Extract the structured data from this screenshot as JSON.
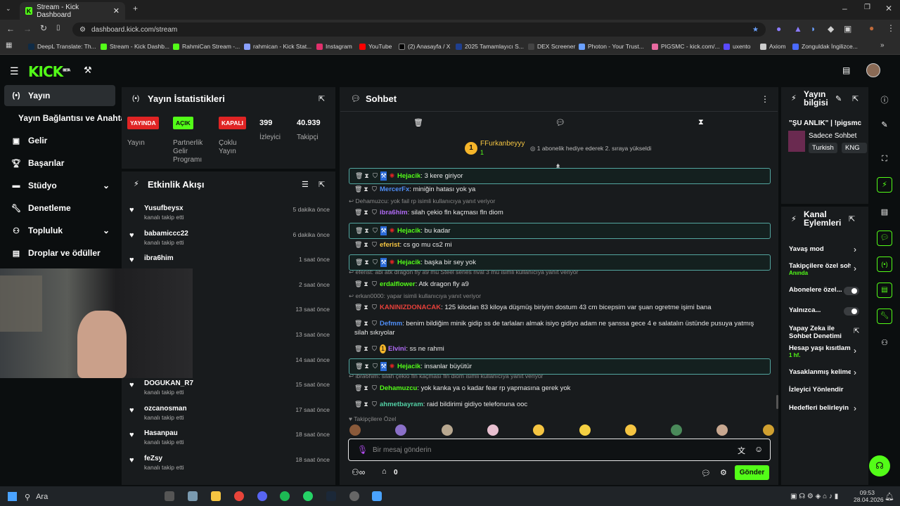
{
  "browser": {
    "tab_title": "Stream - Kick Dashboard",
    "url": "dashboard.kick.com/stream",
    "bookmarks": [
      "DeepL Translate: Th...",
      "Stream - Kick Dashb...",
      "RahmiCan Stream -...",
      "rahmican - Kick Stat...",
      "Instagram",
      "YouTube",
      "(2) Anasayfa / X",
      "2025 Tamamlayıcı S...",
      "DEX Screener",
      "Photon - Your Trust...",
      "PIGSMC - kick.com/...",
      "uxento",
      "Axiom",
      "Zonguldak İngilizce..."
    ]
  },
  "app": {
    "logo": "KICK",
    "logo_sup": "BETA"
  },
  "nav": [
    {
      "label": "Yayın",
      "icon": "broadcast-icon",
      "active": true
    },
    {
      "label": "Yayın Bağlantısı ve Anahtarı",
      "icon": ""
    },
    {
      "label": "Gelir",
      "icon": "money-icon"
    },
    {
      "label": "Başarılar",
      "icon": "trophy-icon"
    },
    {
      "label": "Stüdyo",
      "icon": "studio-icon"
    },
    {
      "label": "Denetleme",
      "icon": "wrench-icon"
    },
    {
      "label": "Topluluk",
      "icon": "community-icon"
    },
    {
      "label": "Droplar ve ödüller",
      "icon": "drops-icon"
    }
  ],
  "stats": {
    "title": "Yayın İstatistikleri",
    "live_badge": "YAYINDA",
    "live_label": "Yayın",
    "partner_badge": "AÇIK",
    "partner_label_1": "Partnerlik",
    "partner_label_2": "Gelir",
    "partner_label_3": "Programı",
    "multi_badge": "KAPALI",
    "multi_label_1": "Çoklu",
    "multi_label_2": "Yayın",
    "viewers_value": "399",
    "viewers_label": "İzleyici",
    "followers_value": "40.939",
    "followers_label": "Takipçi"
  },
  "activity": {
    "title": "Etkinlik Akışı",
    "items": [
      {
        "name": "Yusufbeysx",
        "sub": "kanalı takip etti",
        "time": "5 dakika önce"
      },
      {
        "name": "babamiccc22",
        "sub": "kanalı takip etti",
        "time": "6 dakika önce"
      },
      {
        "name": "ibra6him",
        "sub": "",
        "time": "1 saat önce"
      },
      {
        "name": "",
        "sub": "",
        "time": "2 saat önce"
      },
      {
        "name": "",
        "sub": "",
        "time": "13 saat önce"
      },
      {
        "name": "",
        "sub": "",
        "time": "13 saat önce"
      },
      {
        "name": "",
        "sub": "",
        "time": "14 saat önce"
      },
      {
        "name": "DOGUKAN_R7",
        "sub": "kanalı takip etti",
        "time": "15 saat önce"
      },
      {
        "name": "ozcanosman",
        "sub": "kanalı takip etti",
        "time": "17 saat önce"
      },
      {
        "name": "Hasanpau",
        "sub": "kanalı takip etti",
        "time": "18 saat önce"
      },
      {
        "name": "feZsy",
        "sub": "kanalı takip etti",
        "time": "18 saat önce"
      }
    ]
  },
  "chat": {
    "title": "Sohbet",
    "top_gifter": "FFurkanbeyyy",
    "top_gifter_count": "1",
    "gift_text": "1 abonelik hediye ederek 2. sıraya yükseldi",
    "messages": [
      {
        "user": "Hejacik",
        "text": "3 kere giriyor",
        "color": "#53fc18",
        "hl": true
      },
      {
        "user": "MercerFx",
        "text": "miniğin hatası yok ya",
        "color": "#4f8ef7"
      },
      {
        "reply": "Dehamuzcu: yok fail rp isimli kullanıcıya yanıt veriyor"
      },
      {
        "user": "ibra6him",
        "text": "silah çekio fln kaçması fln diom",
        "color": "#b06bf5"
      },
      {
        "user": "Hejacik",
        "text": "bu kadar",
        "color": "#53fc18",
        "hl": true
      },
      {
        "user": "eferist",
        "text": "cs go mu cs2 mi",
        "color": "#f5c542"
      },
      {
        "user": "Hejacik",
        "text": "başka bir sey yok",
        "color": "#53fc18",
        "hl": true
      },
      {
        "reply": "eferist: abi atk dragon fly a9 mu Steel series rival 3 mu isimli kullanıcıya yanıt veriyor"
      },
      {
        "user": "erdalflower",
        "text": "Atk dragon fly a9",
        "color": "#53fc18"
      },
      {
        "reply": "erkan0000: yapar isimli kullanıcıya yanıt veriyor"
      },
      {
        "user": "KANINIZDONACAK",
        "text": "125 kilodan 83 kiloya düşmüş biriyim dostum 43 cm bicepsim var şuan ogretme işimi bana",
        "color": "#e8403a"
      },
      {
        "user": "Defmm",
        "text": "benim bildiğim minik gidip ss de tarlaları almak isiyo gidiyo adam ne şanssa gece 4 e salatalın üstünde pusuya yatmış silah sıkıyolar",
        "color": "#4f8ef7"
      },
      {
        "user": "Elvini",
        "text": "ss ne rahmi",
        "color": "#b06bf5"
      },
      {
        "user": "Hejacik",
        "text": "insanlar büyütür",
        "color": "#53fc18",
        "hl": true
      },
      {
        "reply": "ibra6him: silah çekio fln kaçması fln diom isimli kullanıcıya yanıt veriyor"
      },
      {
        "user": "Dehamuzcu",
        "text": "yok kanka ya o kadar fear rp yapmasına gerek yok",
        "color": "#53fc18"
      },
      {
        "user": "ahmetbayram",
        "text": "raid bildirimi gidiyo telefonuna ooc",
        "color": "#53d1a6"
      }
    ],
    "followers_only": "Takipçilere Özel",
    "input_placeholder": "Bir mesaj gönderin",
    "points": "0",
    "send": "Gönder"
  },
  "stream_info": {
    "title_1": "Yayın",
    "title_2": "bilgisi",
    "stream_title": "\"ŞU ANLIK\" | !pigsmc",
    "category": "Sadece Sohbet",
    "tag1": "Turkish",
    "tag2": "KNG"
  },
  "channel_actions": {
    "title_1": "Kanal",
    "title_2": "Eylemleri",
    "items": [
      {
        "label": "Yavaş mod",
        "type": "chevron"
      },
      {
        "label": "Takipçilere özel soh",
        "sub": "Anında",
        "type": "chevron"
      },
      {
        "label": "Abonelere özel...",
        "type": "toggle"
      },
      {
        "label": "Yalnızca...",
        "type": "toggle"
      },
      {
        "label": "Yapay Zeka ile",
        "label2": "Sohbet Denetimi",
        "type": "link"
      },
      {
        "label": "Hesap yaşı kısıtlam",
        "sub": "1 hf.",
        "type": "chevron"
      },
      {
        "label": "Yasaklanmış kelime",
        "type": "chevron"
      },
      {
        "label": "İzleyici Yönlendir",
        "type": "none"
      },
      {
        "label": "Hedefleri belirleyin",
        "type": "chevron"
      }
    ]
  },
  "taskbar": {
    "search": "Ara",
    "time": "09:53",
    "date": "28.04.2026"
  }
}
